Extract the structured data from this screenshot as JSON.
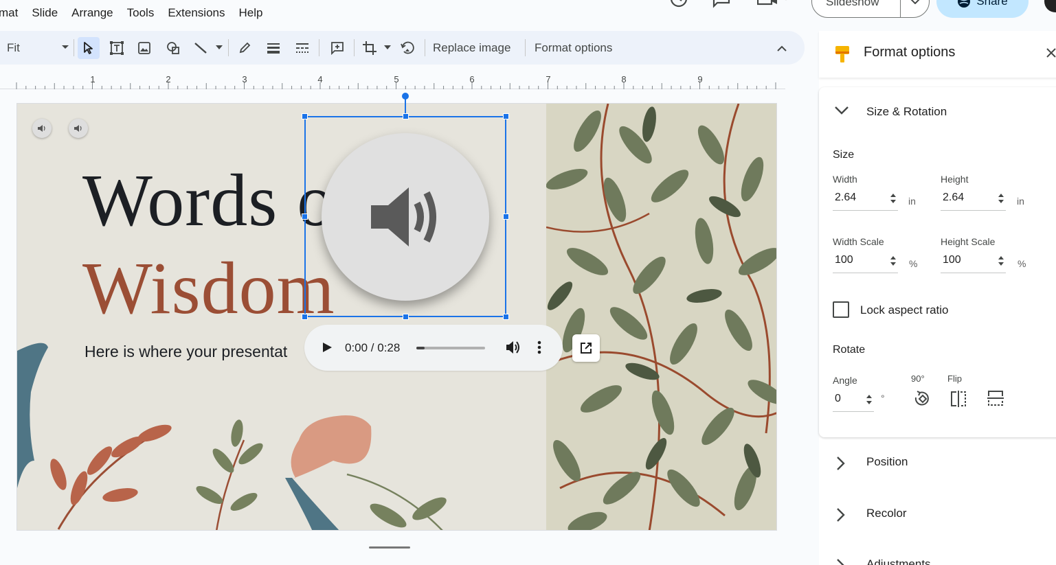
{
  "menu": [
    "mat",
    "Slide",
    "Arrange",
    "Tools",
    "Extensions",
    "Help"
  ],
  "header": {
    "slideshow_label": "Slideshow",
    "share_label": "Share"
  },
  "toolbar": {
    "zoom_value": "Fit",
    "replace_image_label": "Replace image",
    "format_options_label": "Format options"
  },
  "ruler": {
    "numbers": [
      "1",
      "2",
      "3",
      "4",
      "5",
      "6",
      "7",
      "8",
      "9"
    ]
  },
  "slide": {
    "title_line1": "Words o",
    "title_line2": "Wisdom",
    "subtitle": "Here is where your presentat",
    "colors": {
      "title": "#1c1f24",
      "accent": "#9b4e35",
      "background": "#e6e4dc"
    }
  },
  "audio_player": {
    "time": "0:00 / 0:28",
    "progress_fraction": 0.12
  },
  "panel": {
    "title": "Format options",
    "size_rotation": {
      "header": "Size & Rotation",
      "size_label": "Size",
      "width_label": "Width",
      "width_value": "2.64",
      "width_unit": "in",
      "height_label": "Height",
      "height_value": "2.64",
      "height_unit": "in",
      "width_scale_label": "Width Scale",
      "width_scale_value": "100",
      "width_scale_unit": "%",
      "height_scale_label": "Height Scale",
      "height_scale_value": "100",
      "height_scale_unit": "%",
      "lock_aspect_label": "Lock aspect ratio",
      "rotate_label": "Rotate",
      "angle_label": "Angle",
      "angle_value": "0",
      "angle_unit": "°",
      "rotate90_label": "90°",
      "flip_label": "Flip"
    },
    "position_label": "Position",
    "recolor_label": "Recolor",
    "adjustments_label": "Adjustments"
  }
}
